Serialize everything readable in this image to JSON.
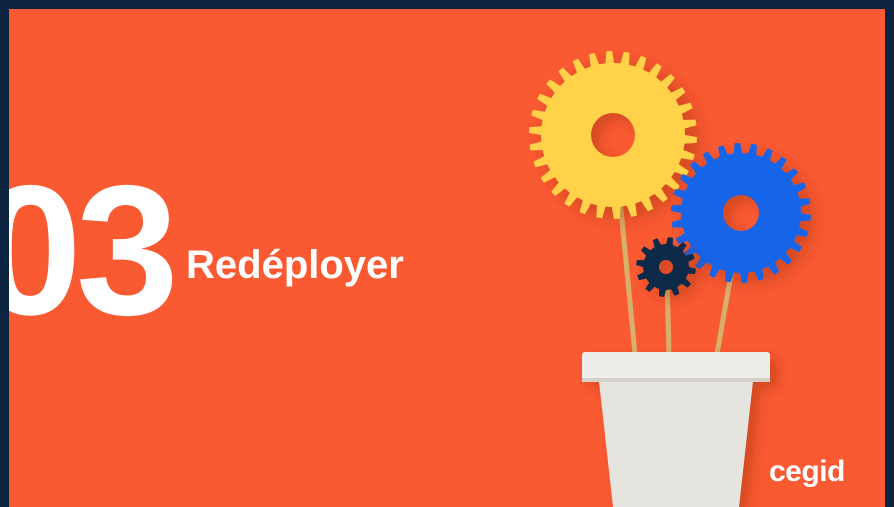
{
  "slide": {
    "number": "03",
    "title": "Redéployer",
    "brand": "cegid"
  },
  "colors": {
    "background": "#fa5a32",
    "frame": "#0d2440",
    "text": "#ffffff",
    "gear_yellow": "#ffd24a",
    "gear_blue": "#1565e8",
    "gear_navy": "#10294a",
    "pot": "#e9e7e2",
    "stick": "#d9b06a"
  },
  "illustration": {
    "icon": "flower-pot-gears-illustration"
  }
}
